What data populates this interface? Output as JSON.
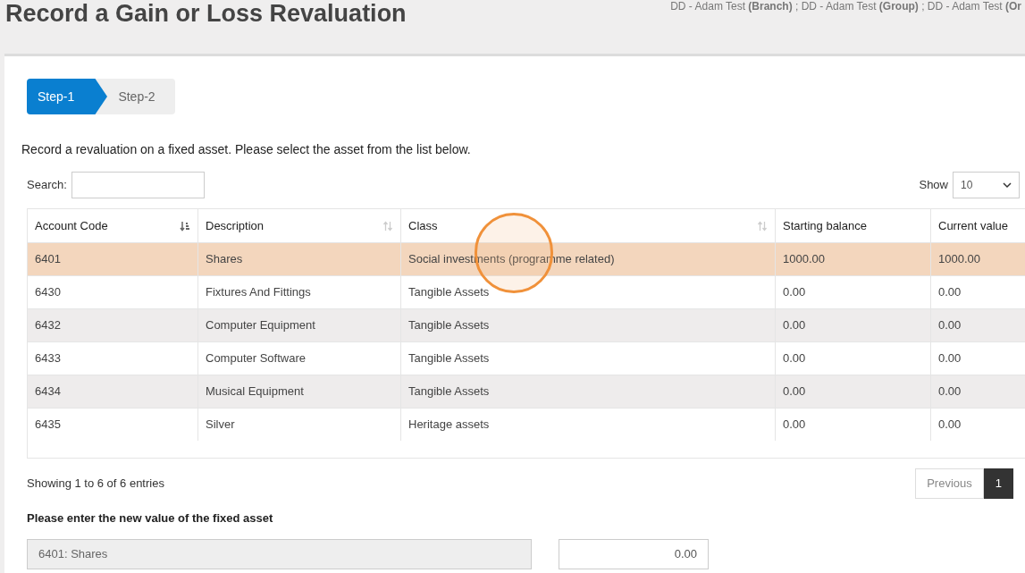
{
  "title": "Record a Gain or Loss Revaluation",
  "user_context": "DD - Adam Test **(Branch)** ; DD - Adam Test **(Group)** ; DD - Adam Test **(Or**",
  "steps": [
    {
      "label": "Step-1",
      "selected": true
    },
    {
      "label": "Step-2",
      "selected": false
    }
  ],
  "instruction": "Record a revaluation on a fixed asset. Please select the asset from the list below.",
  "search": {
    "label": "Search:"
  },
  "show": {
    "label": "Show",
    "value": "10"
  },
  "table": {
    "columns": [
      {
        "label": "Account Code",
        "kind": "sorted"
      },
      {
        "label": "Description",
        "kind": "sortable"
      },
      {
        "label": "Class",
        "kind": "sortable"
      },
      {
        "label": "Starting balance",
        "kind": "plain"
      },
      {
        "label": "Current value",
        "kind": "plain"
      }
    ],
    "rows": [
      {
        "cells": [
          "6401",
          "Shares",
          "Social investments (programme related)",
          "1000.00",
          "1000.00"
        ],
        "selected": true
      },
      {
        "cells": [
          "6430",
          "Fixtures And Fittings",
          "Tangible Assets",
          "0.00",
          "0.00"
        ],
        "selected": false
      },
      {
        "cells": [
          "6432",
          "Computer Equipment",
          "Tangible Assets",
          "0.00",
          "0.00"
        ],
        "selected": false
      },
      {
        "cells": [
          "6433",
          "Computer Software",
          "Tangible Assets",
          "0.00",
          "0.00"
        ],
        "selected": false
      },
      {
        "cells": [
          "6434",
          "Musical Equipment",
          "Tangible Assets",
          "0.00",
          "0.00"
        ],
        "selected": false
      },
      {
        "cells": [
          "6435",
          "Silver",
          "Heritage assets",
          "0.00",
          "0.00"
        ],
        "selected": false
      }
    ]
  },
  "info": "Showing 1 to 6 of 6 entries",
  "pagination": [
    {
      "label": "Previous",
      "selected": false
    },
    {
      "label": "1",
      "selected": true
    }
  ],
  "new_value": {
    "label": "Please enter the new value of the fixed asset",
    "asset": "6401: Shares",
    "value": "0.00"
  }
}
